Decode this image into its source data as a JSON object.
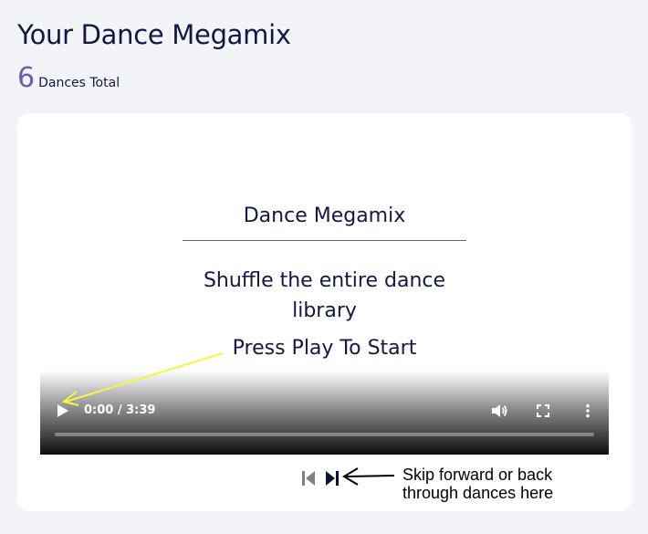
{
  "header": {
    "title": "Your Dance Megamix",
    "count": "6",
    "count_label": "Dances Total"
  },
  "video": {
    "title": "Dance Megamix",
    "subtitle": "Shuffle the entire dance library",
    "cta": "Press Play To Start",
    "time_display": "0:00 / 3:39",
    "progress_fraction": 0
  },
  "navigation": {
    "prev_icon": "skip-back-icon",
    "next_icon": "skip-forward-icon",
    "hint": "Skip forward or back through dances here"
  },
  "colors": {
    "title": "#121843",
    "count": "#6a5db7",
    "background": "#f3f4f7",
    "card": "#ffffff",
    "annotation_yellow": "#f5f542"
  }
}
